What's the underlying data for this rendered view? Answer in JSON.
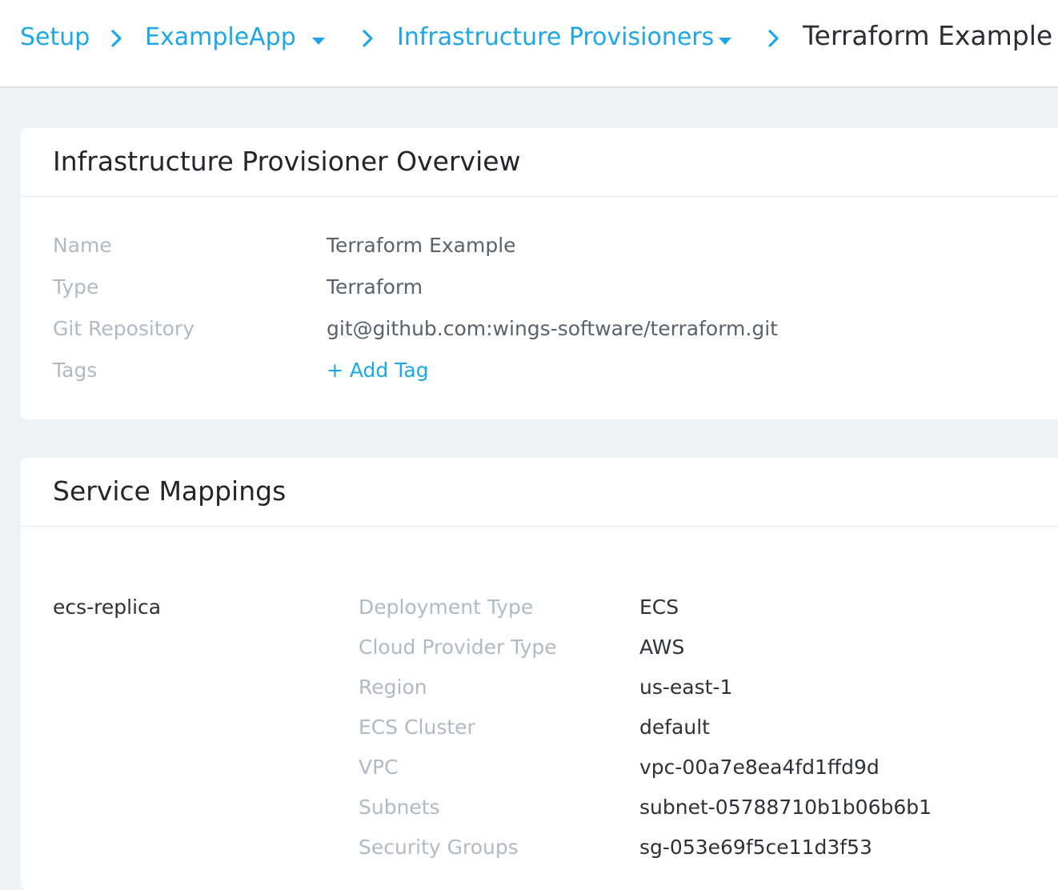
{
  "breadcrumb": {
    "items": [
      {
        "label": "Setup"
      },
      {
        "label": "ExampleApp"
      },
      {
        "label": "Infrastructure Provisioners"
      },
      {
        "label": "Terraform Example"
      }
    ]
  },
  "overview": {
    "title": "Infrastructure Provisioner Overview",
    "fields": [
      {
        "label": "Name",
        "value": "Terraform Example"
      },
      {
        "label": "Type",
        "value": "Terraform"
      },
      {
        "label": "Git Repository",
        "value": "git@github.com:wings-software/terraform.git"
      },
      {
        "label": "Tags",
        "value": "+ Add Tag"
      }
    ]
  },
  "service_mappings": {
    "title": "Service Mappings",
    "mappings": [
      {
        "service": "ecs-replica",
        "fields": [
          {
            "label": "Deployment Type",
            "value": "ECS"
          },
          {
            "label": "Cloud Provider Type",
            "value": "AWS"
          },
          {
            "label": "Region",
            "value": "us-east-1"
          },
          {
            "label": "ECS Cluster",
            "value": "default"
          },
          {
            "label": "VPC",
            "value": "vpc-00a7e8ea4fd1ffd9d"
          },
          {
            "label": "Subnets",
            "value": "subnet-05788710b1b06b6b1"
          },
          {
            "label": "Security Groups",
            "value": "sg-053e69f5ce11d3f53"
          }
        ]
      }
    ]
  },
  "colors": {
    "link": "#1ea7e8",
    "background": "#eff2f5",
    "card": "#ffffff",
    "label": "#b3b9c2",
    "value": "#5b626c"
  }
}
